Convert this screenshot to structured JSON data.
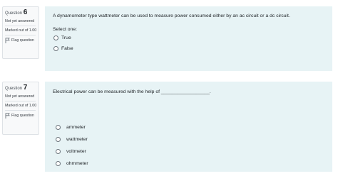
{
  "questions": [
    {
      "label": "Question",
      "number": "6",
      "state": "Not yet answered",
      "marked_out_of": "Marked out of 1.00",
      "flag": "Flag question",
      "text": "A  dynamometer type wattmeter  can be used to measure power consumed either by an ac circuit or a dc circuit.",
      "prompt": "Select one:",
      "options": [
        "True",
        "False"
      ]
    },
    {
      "label": "Question",
      "number": "7",
      "state": "Not yet answered",
      "marked_out_of": "Marked out of 1.00",
      "flag": "Flag question",
      "text": "Electrical power can be measured with the help of __________________.",
      "options": [
        "ammeter",
        "wattmeter",
        "voltmeter",
        "ohmmeter"
      ]
    }
  ]
}
